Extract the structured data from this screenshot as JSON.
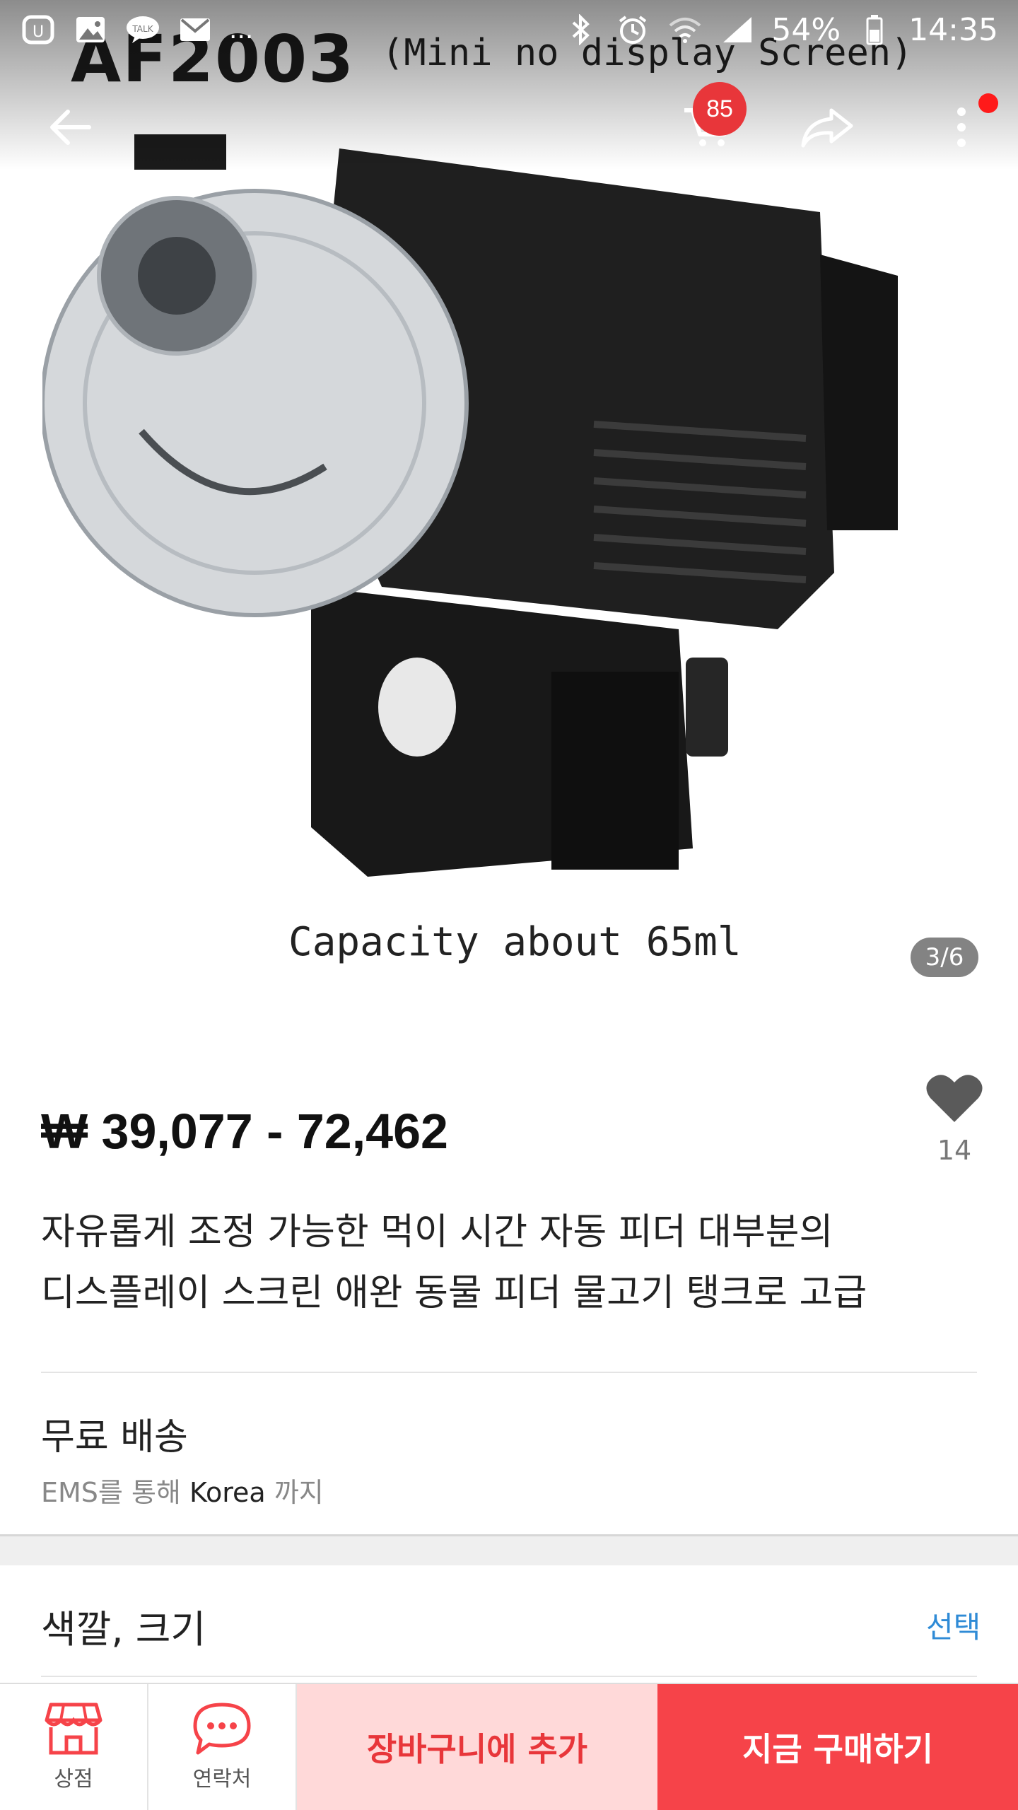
{
  "status_bar": {
    "battery": "54%",
    "time": "14:35",
    "notification_ellipsis": "..."
  },
  "app_bar": {
    "cart_badge": "85"
  },
  "gallery": {
    "image_title": "AF2003",
    "image_subtitle": "(Mini no display Screen)",
    "image_caption": "Capacity about 65ml",
    "page_indicator": "3/6"
  },
  "product": {
    "price": "₩ 39,077 - 72,462",
    "favorite_count": "14",
    "title_line1": "자유롭게 조정 가능한 먹이 시간 자동 피더 대부분의",
    "title_line2": "디스플레이 스크린 애완 동물 피더 물고기 탱크로 고급"
  },
  "shipping": {
    "title": "무료 배송",
    "via_prefix": "EMS를 통해",
    "destination": "Korea",
    "via_suffix": "까지"
  },
  "options": {
    "title": "색깔, 크기",
    "select_label": "선택"
  },
  "bottom_bar": {
    "store_label": "상점",
    "contact_label": "연락처",
    "add_to_cart_label": "장바구니에 추가",
    "buy_now_label": "지금 구매하기"
  },
  "colors": {
    "accent_red": "#f64349",
    "cart_bg": "#ffd9d9",
    "badge_red": "#e8363a",
    "link_blue": "#2f8bd6"
  }
}
